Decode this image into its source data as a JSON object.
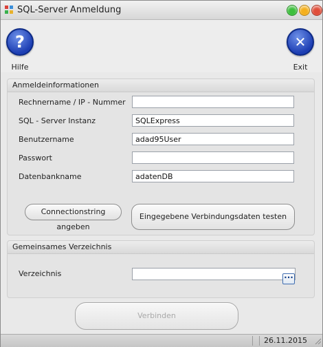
{
  "window": {
    "title": "SQL-Server Anmeldung",
    "buttons": {
      "minimize_color": "#3cbf3c",
      "maximize_color": "#f4b01e",
      "close_color": "#e04e3a"
    }
  },
  "toolbar": {
    "help_label": "Hilfe",
    "help_symbol": "?",
    "exit_label": "Exit",
    "exit_symbol": "✕"
  },
  "login_group": {
    "title": "Anmeldeinformationen",
    "fields": [
      {
        "label": "Rechnername / IP - Nummer",
        "value": ""
      },
      {
        "label": "SQL - Server Instanz",
        "value": "SQLExpress"
      },
      {
        "label": "Benutzername",
        "value": "adad95User"
      },
      {
        "label": "Passwort",
        "value": ""
      },
      {
        "label": "Datenbankname",
        "value": "adatenDB"
      }
    ],
    "connectionstring_button": "Connectionstring angeben",
    "test_button": "Eingegebene Verbindungsdaten testen"
  },
  "directory_group": {
    "title": "Gemeinsames Verzeichnis",
    "label": "Verzeichnis",
    "value": "",
    "browse_button": "···"
  },
  "connect_button": "Verbinden",
  "statusbar": {
    "date": "26.11.2015"
  },
  "colors": {
    "accent": "#1d3eb3",
    "window_bg": "#e9e9e9"
  }
}
